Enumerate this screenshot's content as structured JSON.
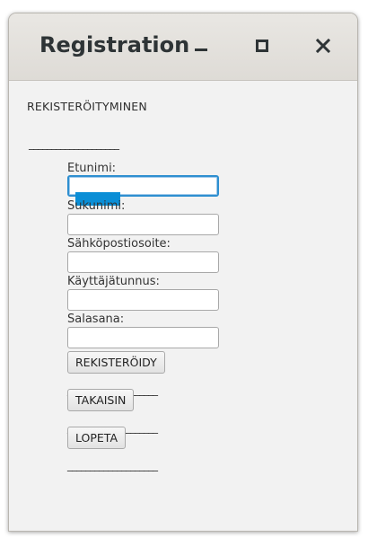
{
  "window": {
    "title": "Registration"
  },
  "form": {
    "header": "REKISTERÖITYMINEN",
    "separator": "____________________",
    "fields": [
      {
        "label": "Etunimi:",
        "value": "",
        "placeholder": ""
      },
      {
        "label": "Sukunimi:",
        "value": "",
        "placeholder": ""
      },
      {
        "label": "Sähköpostiosoite:",
        "value": "",
        "placeholder": ""
      },
      {
        "label": "Käyttäjätunnus:",
        "value": "",
        "placeholder": ""
      },
      {
        "label": "Salasana:",
        "value": "",
        "placeholder": ""
      }
    ],
    "buttons": {
      "register": "REKISTERÖIDY",
      "back": "TAKAISIN",
      "quit": "LOPETA"
    }
  },
  "colors": {
    "accent": "#2e8fd0",
    "selection": "#0a8ed6",
    "window_bg": "#f2f2f2",
    "titlebar_bg": "#e3e1dd"
  },
  "icons": {
    "minimize": "minimize-icon",
    "maximize": "maximize-icon",
    "close": "close-icon"
  }
}
